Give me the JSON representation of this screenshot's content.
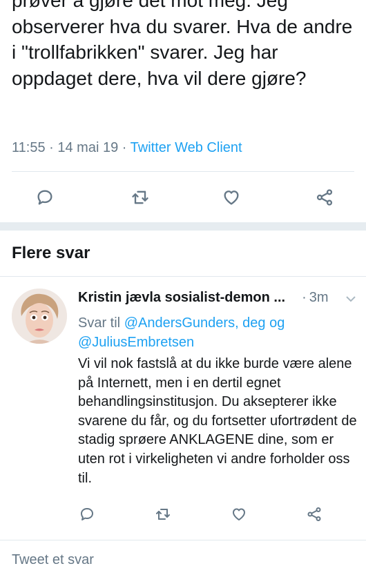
{
  "tweet": {
    "text_line0": "prøver å gjøre det mot meg. Jeg",
    "text": "observerer hva du svarer. Hva de andre i \"trollfabrikken\" svarer. Jeg har oppdaget dere, hva vil dere gjøre?",
    "time": "11:55",
    "sep1": "·",
    "date": "14 mai 19",
    "sep2": "·",
    "client": "Twitter Web Client"
  },
  "actions": {
    "reply_icon": "reply-icon",
    "retweet_icon": "retweet-icon",
    "like_icon": "heart-icon",
    "share_icon": "share-icon"
  },
  "section": {
    "title": "Flere svar"
  },
  "reply": {
    "author": "Kristin jævla sosialist-demon ...",
    "sep": "·",
    "time": "3m",
    "reply_to_prefix": "Svar til",
    "mention1": "@AndersGunders, deg og",
    "mention2": "@JuliusEmbretsen",
    "body": "Vi vil nok fastslå at du ikke burde være alene på Internett, men i en dertil egnet behandlingsinstitusjon. Du aksepterer ikke svarene du får, og du fortsetter ufortrødent de stadig sprøere ANKLAGENE dine, som er uten rot i virkeligheten vi andre forholder oss til."
  },
  "compose": {
    "placeholder": "Tweet et svar"
  },
  "colors": {
    "accent": "#1da1f2",
    "muted": "#657786",
    "text": "#14171a",
    "divider": "#e6ecf0"
  }
}
